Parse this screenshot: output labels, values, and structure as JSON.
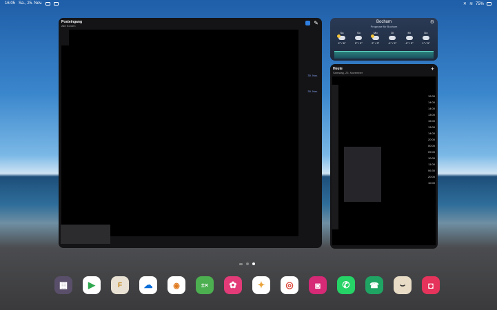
{
  "status_bar": {
    "time": "16:05",
    "date": "Sa., 25. Nov.",
    "battery": "75%"
  },
  "mail_widget": {
    "title": "Posteingang",
    "subtitle": "Alle Konten",
    "dates": [
      "30. Nov.",
      "30. Nov."
    ]
  },
  "weather_widget": {
    "city": "Bochum",
    "subtitle": "Prognose für Bochum",
    "days": [
      {
        "day": "Sa",
        "temp": "2° / 6°",
        "icon": "partly-cloudy-icon"
      },
      {
        "day": "So",
        "temp": "2° / 2°",
        "icon": "cloud-icon"
      },
      {
        "day": "Mo",
        "temp": "2° / 3°",
        "icon": "partly-cloudy-icon"
      },
      {
        "day": "Di",
        "temp": "-1° / 2°",
        "icon": "cloud-icon"
      },
      {
        "day": "Mi",
        "temp": "-1° / 2°",
        "icon": "cloud-icon"
      },
      {
        "day": "Do",
        "temp": "1° / 3°",
        "icon": "cloud-icon"
      }
    ]
  },
  "calendar_widget": {
    "title": "Heute",
    "subtitle": "Samstag, 25. November",
    "times": [
      "12:00",
      "14:00",
      "14:00",
      "13:00",
      "15:00",
      "13:00",
      "14:00",
      "20:00",
      "00:00",
      "09:00",
      "10:00",
      "11:00",
      "06:30",
      "20:00",
      "10:00"
    ]
  },
  "page_dots": {
    "count": 3,
    "active_index": 2
  },
  "dock": {
    "apps": [
      {
        "name": "folder-apps",
        "icon": "folder-icon",
        "color": "#5a4f6a"
      },
      {
        "name": "play-store",
        "icon": "play-store-icon",
        "color": "#ffffff"
      },
      {
        "name": "files",
        "icon": "file-manager-icon",
        "color": "#e9e2d4"
      },
      {
        "name": "onedrive",
        "icon": "cloud-icon",
        "color": "#ffffff"
      },
      {
        "name": "app-orange",
        "icon": "shield-icon",
        "color": "#ffffff"
      },
      {
        "name": "calculator",
        "icon": "calculator-icon",
        "color": "#4caf50"
      },
      {
        "name": "blossom",
        "icon": "flower-icon",
        "color": "#e23b78"
      },
      {
        "name": "photos",
        "icon": "pinwheel-icon",
        "color": "#ffffff"
      },
      {
        "name": "chrome",
        "icon": "chrome-icon",
        "color": "#ffffff"
      },
      {
        "name": "instagram",
        "icon": "instagram-icon",
        "color": "#d62976"
      },
      {
        "name": "whatsapp",
        "icon": "whatsapp-icon",
        "color": "#25d366"
      },
      {
        "name": "phone",
        "icon": "phone-icon",
        "color": "#1fa463"
      },
      {
        "name": "amazon",
        "icon": "amazon-icon",
        "color": "#e8dcc6"
      },
      {
        "name": "camera",
        "icon": "camera-icon",
        "color": "#e5335b"
      }
    ]
  }
}
